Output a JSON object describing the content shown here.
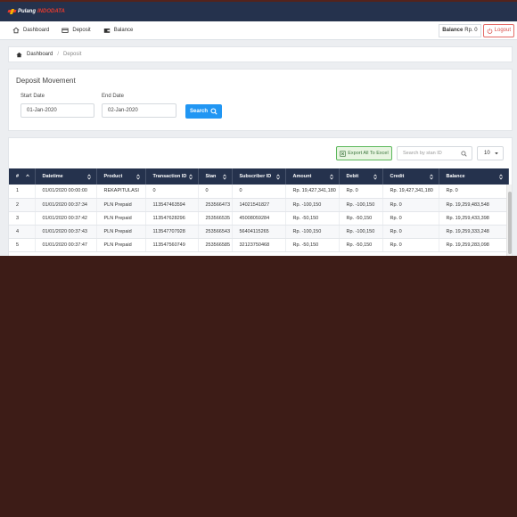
{
  "brand": {
    "name_part1": "Pulang",
    "name_part2": "INDODATA"
  },
  "nav": {
    "items": [
      {
        "label": "Dashboard",
        "icon": "home-icon"
      },
      {
        "label": "Deposit",
        "icon": "card-icon"
      },
      {
        "label": "Balance",
        "icon": "wallet-icon"
      }
    ],
    "balance_label": "Balance",
    "balance_value": "Rp. 0",
    "logout_label": "Logout"
  },
  "breadcrumb": {
    "home": "Dashboard",
    "separator": "/",
    "current": "Deposit"
  },
  "filter": {
    "title": "Deposit Movement",
    "start_label": "Start Date",
    "start_value": "01-Jan-2020",
    "end_label": "End Date",
    "end_value": "02-Jan-2020",
    "search_label": "Search"
  },
  "table_tools": {
    "export_label": "Export All To Excel",
    "search_placeholder": "Search by stan ID",
    "page_size": "10"
  },
  "table": {
    "columns": [
      "#",
      "Datetime",
      "Product",
      "Transaction ID",
      "Stan",
      "Subscriber ID",
      "Amount",
      "Debit",
      "Credit",
      "Balance"
    ],
    "rows": [
      [
        "1",
        "01/01/2020 00:00:00",
        "REKAPITULASI",
        "0",
        "0",
        "0",
        "Rp. 19,427,341,180",
        "Rp. 0",
        "Rp. 19,427,341,180",
        "Rp. 0"
      ],
      [
        "2",
        "01/01/2020 00:37:34",
        "PLN Prepaid",
        "113547463594",
        "253566473",
        "14021541827",
        "Rp. -100,150",
        "Rp. -100,150",
        "Rp. 0",
        "Rp. 19,259,483,548"
      ],
      [
        "3",
        "01/01/2020 00:37:42",
        "PLN Prepaid",
        "113547628296",
        "253566535",
        "45008059284",
        "Rp. -50,150",
        "Rp. -50,150",
        "Rp. 0",
        "Rp. 19,259,433,398"
      ],
      [
        "4",
        "01/01/2020 00:37:43",
        "PLN Prepaid",
        "113547707928",
        "253566543",
        "56404115265",
        "Rp. -100,150",
        "Rp. -100,150",
        "Rp. 0",
        "Rp. 19,259,333,248"
      ],
      [
        "5",
        "01/01/2020 00:37:47",
        "PLN Prepaid",
        "113547560749",
        "253566585",
        "32123750468",
        "Rp. -50,150",
        "Rp. -50,150",
        "Rp. 0",
        "Rp. 19,259,283,098"
      ]
    ]
  },
  "colors": {
    "header_bg": "#25324d",
    "primary": "#2196f3",
    "danger": "#d9534f",
    "success": "#5cb85c",
    "backdrop": "#3d1c17"
  }
}
